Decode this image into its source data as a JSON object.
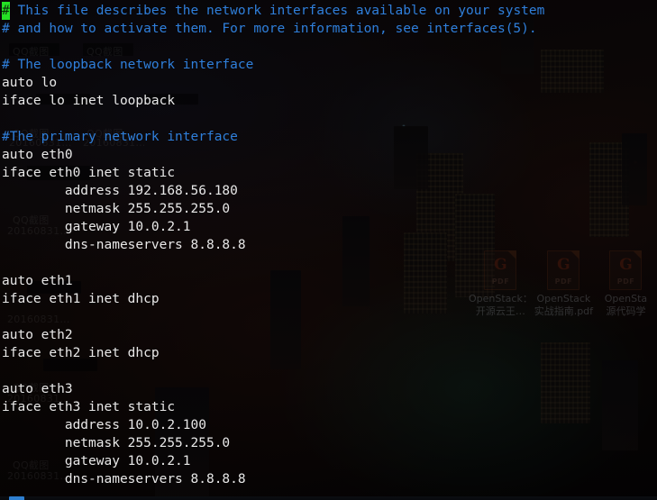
{
  "desktop": {
    "wallpaper_description": "dark night cityscape",
    "watermarks": [
      {
        "label": "QQ截图",
        "date": "20160831…"
      }
    ],
    "icons": [
      {
        "name": "OpenStack：开源云王…",
        "line1": "OpenStack：",
        "line2": "开源云王…",
        "type": "pdf",
        "badge": "PDF",
        "logo": "G"
      },
      {
        "name": "OpenStack 实战指南.pdf",
        "line1": "OpenStack",
        "line2": "实战指南.pdf",
        "type": "pdf",
        "badge": "PDF",
        "logo": "G"
      },
      {
        "name": "OpenSta… 源代码学…",
        "line1": "OpenSta",
        "line2": "源代码学",
        "type": "pdf",
        "badge": "PDF",
        "logo": "G"
      }
    ]
  },
  "terminal": {
    "colors": {
      "text": "#e8e8e8",
      "comment": "#2f7fdb",
      "cursor_bg": "#25e025",
      "cursor_fg": "#0a2a0a",
      "background": "rgba(0,0,0,0.34)"
    },
    "cursor": {
      "char": "#",
      "line": 0,
      "column": 0
    },
    "file_kind": "/etc/network/interfaces",
    "lines": [
      {
        "cursor_char": "#",
        "rest": " This file describes the network interfaces available on your system",
        "style": "comment"
      },
      {
        "text": "# and how to activate them. For more information, see interfaces(5).",
        "style": "comment"
      },
      {
        "text": "",
        "style": "blank"
      },
      {
        "text": "# The loopback network interface",
        "style": "comment"
      },
      {
        "text": "auto lo",
        "style": "text"
      },
      {
        "text": "iface lo inet loopback",
        "style": "text"
      },
      {
        "text": "",
        "style": "blank"
      },
      {
        "text": "#The primary network interface",
        "style": "comment"
      },
      {
        "text": "auto eth0",
        "style": "text"
      },
      {
        "text": "iface eth0 inet static",
        "style": "text"
      },
      {
        "text": "        address 192.168.56.180",
        "style": "text"
      },
      {
        "text": "        netmask 255.255.255.0",
        "style": "text"
      },
      {
        "text": "        gateway 10.0.2.1",
        "style": "text"
      },
      {
        "text": "        dns-nameservers 8.8.8.8",
        "style": "text"
      },
      {
        "text": "",
        "style": "blank"
      },
      {
        "text": "auto eth1",
        "style": "text"
      },
      {
        "text": "iface eth1 inet dhcp",
        "style": "text"
      },
      {
        "text": "",
        "style": "blank"
      },
      {
        "text": "auto eth2",
        "style": "text"
      },
      {
        "text": "iface eth2 inet dhcp",
        "style": "text"
      },
      {
        "text": "",
        "style": "blank"
      },
      {
        "text": "auto eth3",
        "style": "text"
      },
      {
        "text": "iface eth3 inet static",
        "style": "text"
      },
      {
        "text": "        address 10.0.2.100",
        "style": "text"
      },
      {
        "text": "        netmask 255.255.255.0",
        "style": "text"
      },
      {
        "text": "        gateway 10.0.2.1",
        "style": "text"
      },
      {
        "text": "        dns-nameservers 8.8.8.8",
        "style": "text"
      }
    ]
  }
}
